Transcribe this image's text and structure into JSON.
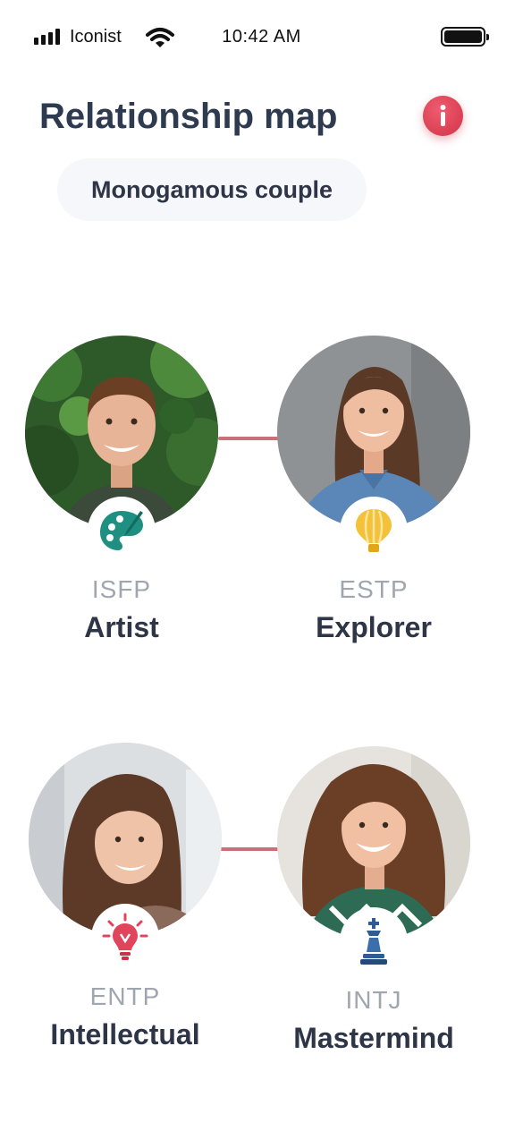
{
  "status_bar": {
    "carrier": "Iconist",
    "time": "10:42 AM"
  },
  "header": {
    "title": "Relationship map"
  },
  "relationship_type": "Monogamous couple",
  "people": [
    {
      "mbti": "ISFP",
      "type": "Artist",
      "icon": "palette-icon"
    },
    {
      "mbti": "ESTP",
      "type": "Explorer",
      "icon": "hot-air-balloon-icon"
    },
    {
      "mbti": "ENTP",
      "type": "Intellectual",
      "icon": "lightbulb-icon"
    },
    {
      "mbti": "INTJ",
      "type": "Mastermind",
      "icon": "chess-king-icon"
    }
  ],
  "colors": {
    "title": "#2e3a4f",
    "accent_red": "#d9394e",
    "link_line": "#c9707b",
    "muted": "#a0a6b0"
  }
}
